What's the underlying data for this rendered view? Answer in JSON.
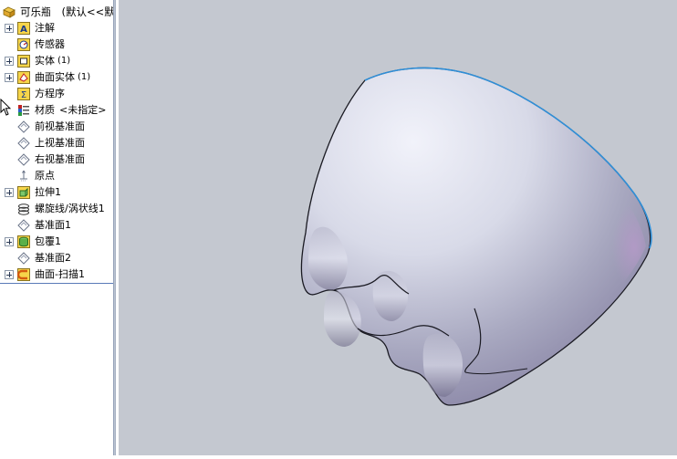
{
  "tree": {
    "root": {
      "label": "可乐瓶",
      "config": "(默认<<默",
      "icon": "part-icon"
    },
    "items": [
      {
        "label": "注解",
        "icon": "annotation-icon",
        "expandable": true
      },
      {
        "label": "传感器",
        "icon": "sensor-icon",
        "expandable": false
      },
      {
        "label": "实体",
        "count": "(1)",
        "icon": "solid-bodies-icon",
        "expandable": true
      },
      {
        "label": "曲面实体",
        "count": "(1)",
        "icon": "surface-bodies-icon",
        "expandable": true
      },
      {
        "label": "方程序",
        "icon": "equations-icon",
        "expandable": false
      },
      {
        "label": "材质",
        "value": "<未指定>",
        "icon": "material-icon",
        "expandable": false
      },
      {
        "label": "前视基准面",
        "icon": "plane-icon",
        "expandable": false
      },
      {
        "label": "上视基准面",
        "icon": "plane-icon",
        "expandable": false
      },
      {
        "label": "右视基准面",
        "icon": "plane-icon",
        "expandable": false
      },
      {
        "label": "原点",
        "icon": "origin-icon",
        "expandable": false
      },
      {
        "label": "拉伸1",
        "icon": "extrude-icon",
        "expandable": true
      },
      {
        "label": "螺旋线/涡状线1",
        "icon": "helix-icon",
        "expandable": false
      },
      {
        "label": "基准面1",
        "icon": "plane-icon",
        "expandable": false
      },
      {
        "label": "包覆1",
        "icon": "wrap-icon",
        "expandable": true
      },
      {
        "label": "基准面2",
        "icon": "plane-icon",
        "expandable": false
      },
      {
        "label": "曲面-扫描1",
        "icon": "sweep-surface-icon",
        "expandable": true
      }
    ]
  },
  "colors": {
    "viewport_bg": "#c4c8d0",
    "edge_highlight": "#2f8fd8",
    "model_light": "#eceef8",
    "model_dark": "#6e6c8a"
  }
}
